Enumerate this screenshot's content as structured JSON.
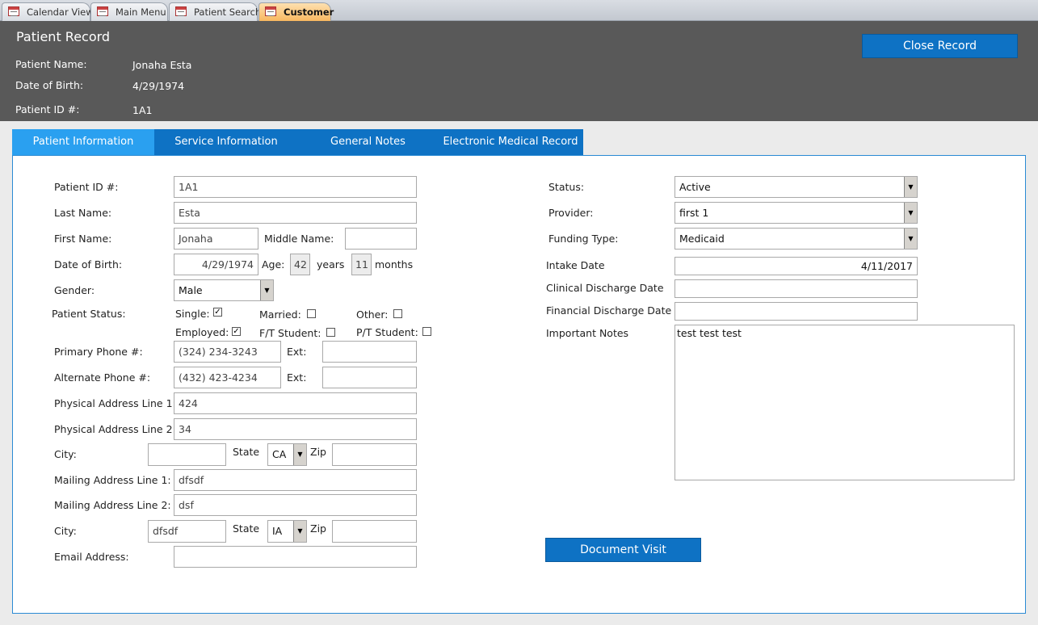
{
  "doc_tabs": [
    "Calendar View",
    "Main Menu",
    "Patient Search",
    "Customer"
  ],
  "header": {
    "title": "Patient Record",
    "name_label": "Patient Name:",
    "name": "Jonaha Esta",
    "dob_label": "Date of Birth:",
    "dob": "4/29/1974",
    "id_label": "Patient ID #:",
    "id": "1A1",
    "close_button": "Close Record"
  },
  "nav_tabs": [
    "Patient Information",
    "Service Information",
    "General Notes",
    "Electronic Medical Record"
  ],
  "form": {
    "patient_id_label": "Patient ID #:",
    "patient_id": "1A1",
    "last_name_label": "Last Name:",
    "last_name": "Esta",
    "first_name_label": "First Name:",
    "first_name": "Jonaha",
    "middle_name_label": "Middle Name:",
    "middle_name": "",
    "dob_label": "Date of Birth:",
    "dob": "4/29/1974",
    "age_label": "Age:",
    "age_years": "42",
    "years_label": "years",
    "age_months": "11",
    "months_label": "months",
    "gender_label": "Gender:",
    "gender": "Male",
    "status_label": "Patient Status:",
    "single_label": "Single:",
    "single": true,
    "married_label": "Married:",
    "married": false,
    "other_label": "Other:",
    "other": false,
    "employed_label": "Employed:",
    "employed": true,
    "ft_label": "F/T Student:",
    "ft": false,
    "pt_label": "P/T Student:",
    "pt": false,
    "primary_phone_label": "Primary Phone #:",
    "primary_phone": "(324) 234-3243",
    "ext_label": "Ext:",
    "primary_ext": "",
    "alt_phone_label": "Alternate Phone #:",
    "alt_phone": "(432) 423-4234",
    "alt_ext": "",
    "phys1_label": "Physical Address Line 1:",
    "phys1": "424",
    "phys2_label": "Physical Address Line 2:",
    "phys2": "34",
    "city_label": "City:",
    "phys_city": "",
    "state_label": "State",
    "phys_state": "CA",
    "zip_label": "Zip",
    "phys_zip": "",
    "mail1_label": "Mailing Address Line 1:",
    "mail1": "dfsdf",
    "mail2_label": "Mailing Address Line 2:",
    "mail2": "dsf",
    "mail_city": "dfsdf",
    "mail_state": "IA",
    "mail_zip": "",
    "email_label": "Email Address:",
    "email": ""
  },
  "right": {
    "status_label": "Status:",
    "status": "Active",
    "provider_label": "Provider:",
    "provider": "first 1",
    "funding_label": "Funding Type:",
    "funding": "Medicaid",
    "intake_label": "Intake Date",
    "intake": "4/11/2017",
    "clinical_label": "Clinical Discharge Date",
    "clinical": "",
    "financial_label": "Financial Discharge Date",
    "financial": "",
    "notes_label": "Important Notes",
    "notes": "test test test",
    "document_visit": "Document Visit"
  },
  "colors": {
    "header_bg": "#595959",
    "tab_active": "#2aa0f0",
    "tab": "#0e72c4",
    "button": "#0e72c4"
  }
}
